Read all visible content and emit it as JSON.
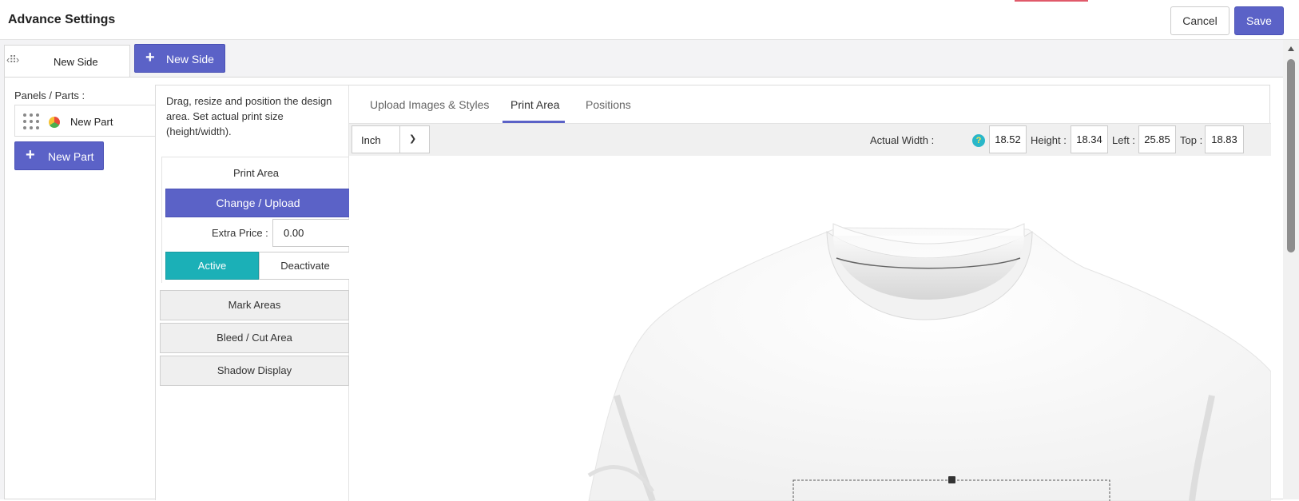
{
  "window": {
    "title": "Advance Settings",
    "cancel_label": "Cancel",
    "save_label": "Save"
  },
  "sides": {
    "tabs": [
      {
        "label": "New Side"
      }
    ],
    "new_side_label": "New Side"
  },
  "parts": {
    "heading": "Panels / Parts :",
    "items": [
      {
        "label": "New Part"
      }
    ],
    "new_part_label": "New Part"
  },
  "editor": {
    "description": "Drag, resize and position the design area. Set actual print size (height/width).",
    "print_area": {
      "title": "Print Area",
      "change_label": "Change / Upload",
      "extra_price_label": "Extra Price :",
      "extra_price_value": "0.00",
      "active_label": "Active",
      "deactivate_label": "Deactivate",
      "status": "Active"
    },
    "sections": [
      "Mark Areas",
      "Bleed / Cut Area",
      "Shadow Display"
    ],
    "tabs": [
      {
        "label": "Upload Images & Styles",
        "active": false
      },
      {
        "label": "Print Area",
        "active": true
      },
      {
        "label": "Positions",
        "active": false
      }
    ],
    "unit": "Inch",
    "dimensions": {
      "width_label": "Actual Width :",
      "width": "18.52",
      "height_label": "Height :",
      "height": "18.34",
      "left_label": "Left :",
      "left": "25.85",
      "top_label": "Top :",
      "top": "18.83"
    }
  },
  "colors": {
    "primary": "#5b62c7",
    "active": "#1bb0b7",
    "help_icon": "#2ab7c9"
  }
}
